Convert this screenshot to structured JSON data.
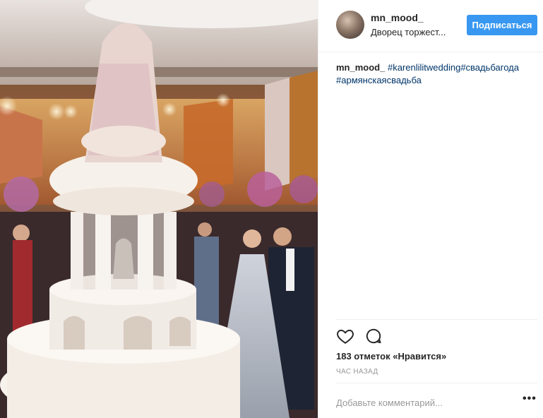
{
  "post": {
    "photo_description_icon": "photo",
    "header": {
      "username": "mn_mood_",
      "location": "Дворец торжест...",
      "follow_label": "Подписаться",
      "accent_color": "#3897f0"
    },
    "caption": {
      "username": "mn_mood_",
      "hashtags": [
        "#karenlilitwedding",
        "#свадьбагода",
        "#армянскаясвадьба"
      ]
    },
    "actions": {
      "like_icon": "heart-icon",
      "comment_icon": "comment-icon"
    },
    "likes_text": "183 отметок «Нравится»",
    "time_text": "ЧАС НАЗАД",
    "comment": {
      "placeholder": "Добавьте комментарий...",
      "more_label": "•••"
    },
    "hashtag_color": "#003569"
  }
}
